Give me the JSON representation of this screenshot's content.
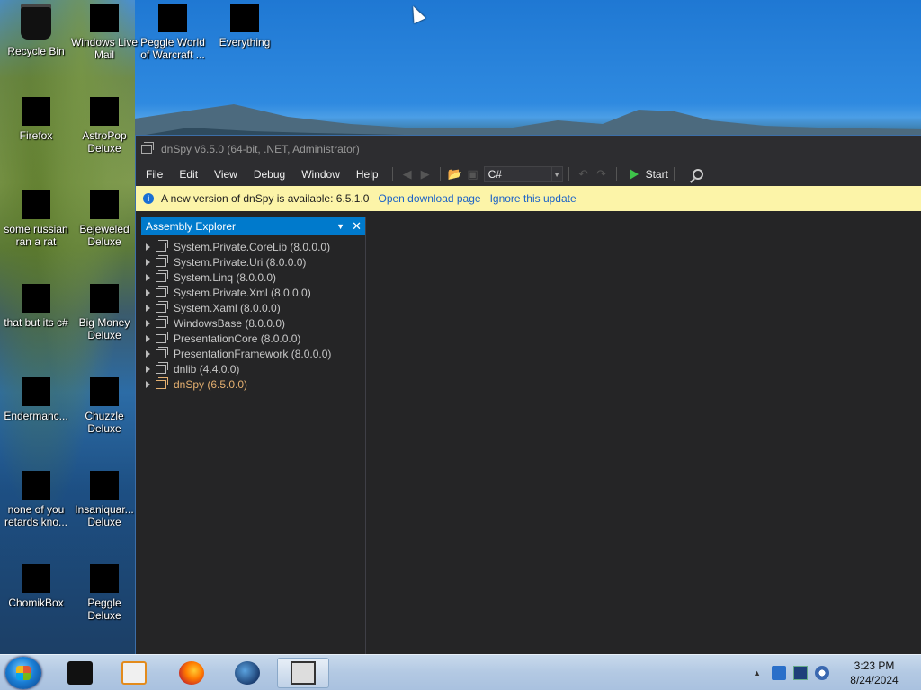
{
  "desktop": {
    "icons": [
      {
        "name": "recycle-bin",
        "label": "Recycle Bin"
      },
      {
        "name": "windows-live-mail",
        "label": "Windows Live Mail"
      },
      {
        "name": "peggle-world-of-warcraft",
        "label": "Peggle World of Warcraft ..."
      },
      {
        "name": "everything",
        "label": "Everything"
      },
      {
        "name": "firefox",
        "label": "Firefox"
      },
      {
        "name": "astropop-deluxe",
        "label": "AstroPop Deluxe"
      },
      {
        "name": "some-russian-ran-a-rat",
        "label": "some russian ran a rat"
      },
      {
        "name": "bejeweled-deluxe",
        "label": "Bejeweled Deluxe"
      },
      {
        "name": "that-but-its-csharp",
        "label": "that but its c#"
      },
      {
        "name": "big-money-deluxe",
        "label": "Big Money Deluxe"
      },
      {
        "name": "endermanch",
        "label": "Endermanc..."
      },
      {
        "name": "chuzzle-deluxe",
        "label": "Chuzzle Deluxe"
      },
      {
        "name": "none-of-you-retards",
        "label": "none of you retards kno..."
      },
      {
        "name": "insaniquarium-deluxe",
        "label": "Insaniquar... Deluxe"
      },
      {
        "name": "chomikbox",
        "label": "ChomikBox"
      },
      {
        "name": "peggle-deluxe",
        "label": "Peggle Deluxe"
      }
    ]
  },
  "window": {
    "title": "dnSpy v6.5.0 (64-bit, .NET, Administrator)",
    "menu": [
      "File",
      "Edit",
      "View",
      "Debug",
      "Window",
      "Help"
    ],
    "toolbar": {
      "language": "C#",
      "start_label": "Start"
    },
    "infobar": {
      "message": "A new version of dnSpy is available: 6.5.1.0",
      "open_link": "Open download page",
      "ignore_link": "Ignore this update"
    },
    "explorer": {
      "title": "Assembly Explorer",
      "items": [
        {
          "label": "System.Private.CoreLib (8.0.0.0)",
          "highlight": false
        },
        {
          "label": "System.Private.Uri (8.0.0.0)",
          "highlight": false
        },
        {
          "label": "System.Linq (8.0.0.0)",
          "highlight": false
        },
        {
          "label": "System.Private.Xml (8.0.0.0)",
          "highlight": false
        },
        {
          "label": "System.Xaml (8.0.0.0)",
          "highlight": false
        },
        {
          "label": "WindowsBase (8.0.0.0)",
          "highlight": false
        },
        {
          "label": "PresentationCore (8.0.0.0)",
          "highlight": false
        },
        {
          "label": "PresentationFramework (8.0.0.0)",
          "highlight": false
        },
        {
          "label": "dnlib (4.4.0.0)",
          "highlight": false
        },
        {
          "label": "dnSpy (6.5.0.0)",
          "highlight": true
        }
      ]
    }
  },
  "taskbar": {
    "apps": [
      "terminal",
      "media-player",
      "firefox",
      "browser-globe",
      "dnspy"
    ],
    "clock_time": "3:23 PM",
    "clock_date": "8/24/2024"
  }
}
